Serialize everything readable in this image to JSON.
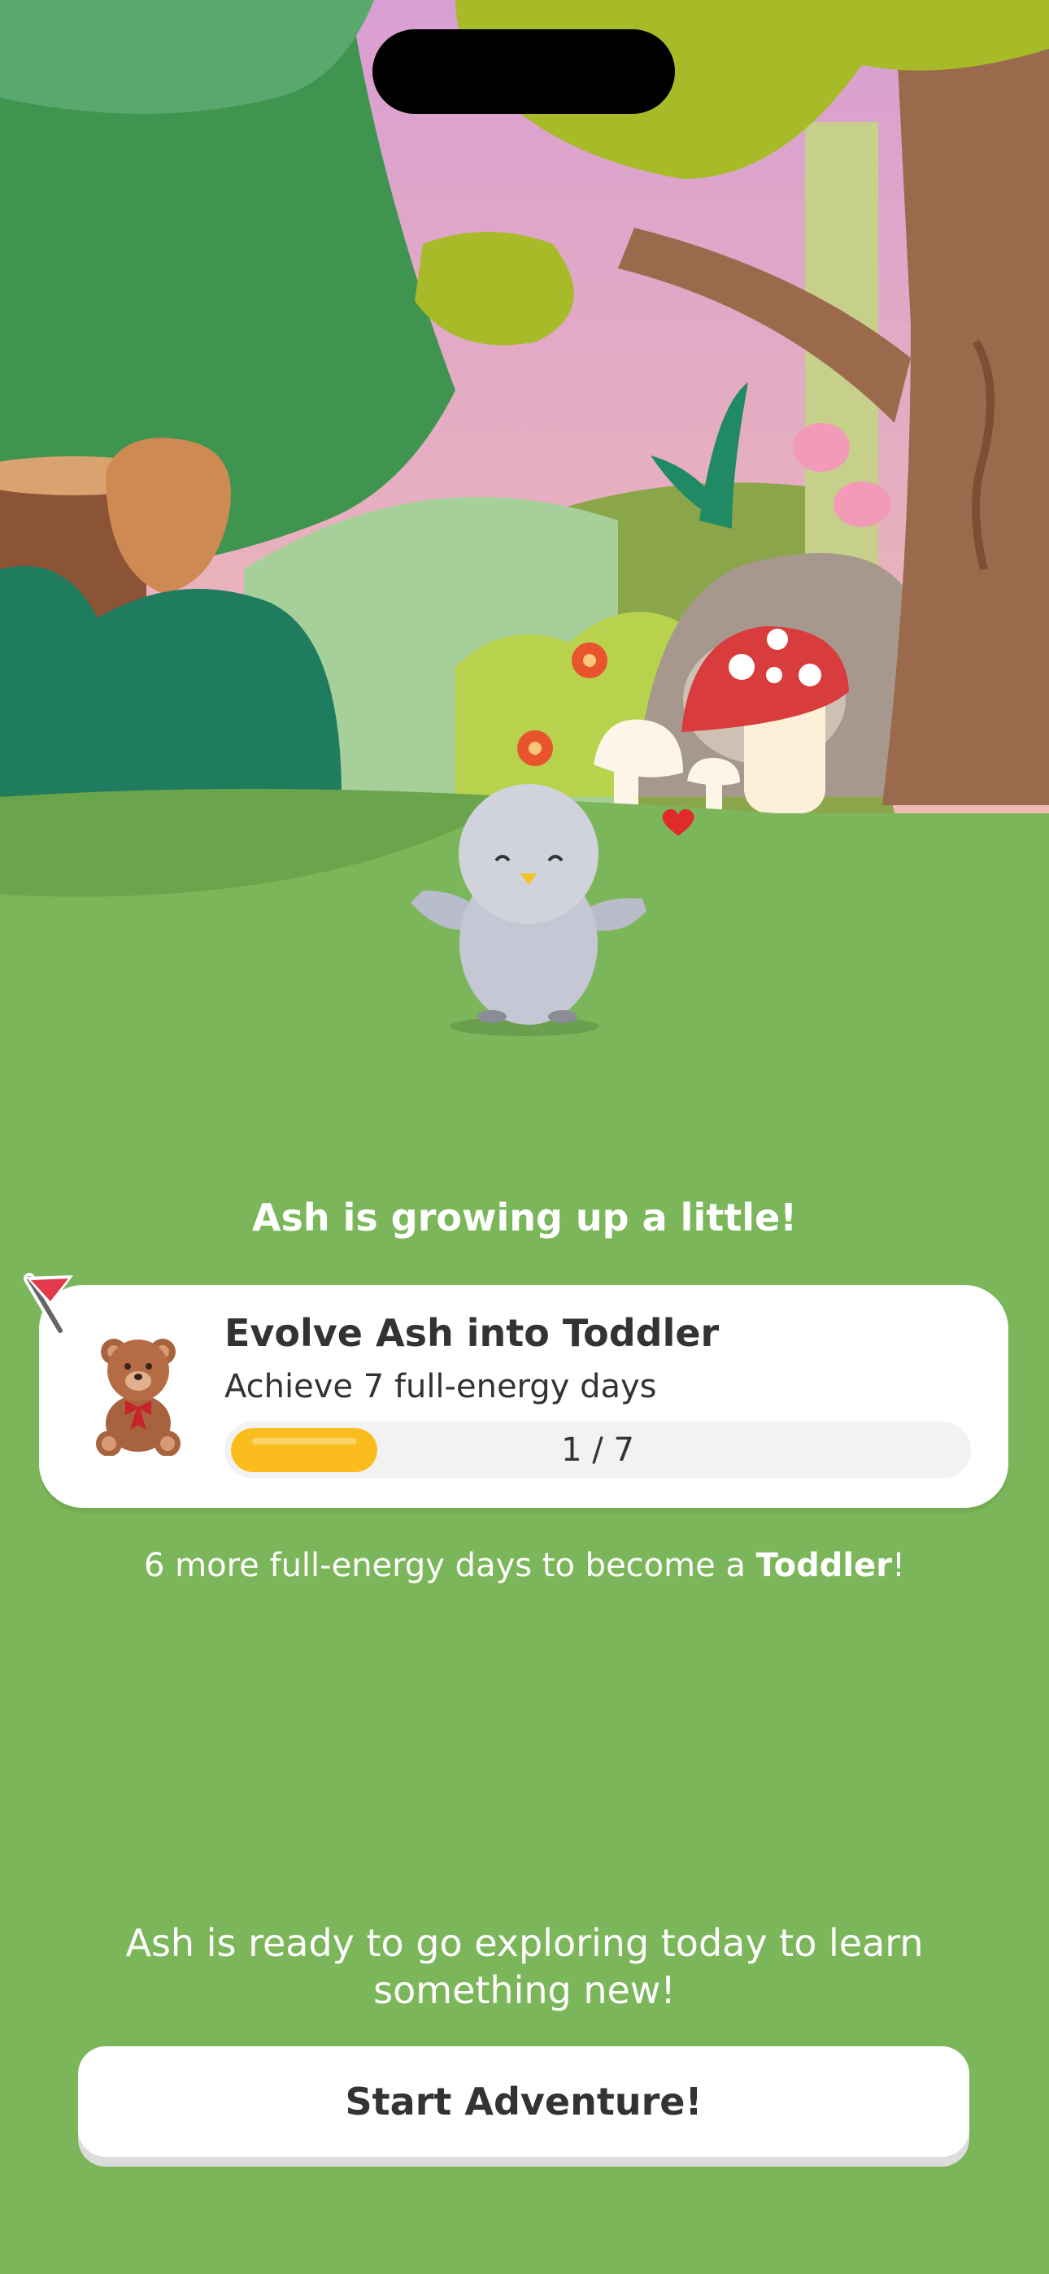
{
  "scene": {
    "pet_name": "Ash",
    "colors": {
      "sky_top": "#d89fd2",
      "sky_bottom": "#f0b9b3",
      "grass": "#7cb65a",
      "tree_dark": "#3f9450",
      "trunk": "#9b6a4c",
      "canopy": "#a6bb27"
    }
  },
  "headline": "Ash is growing up a little!",
  "goal_card": {
    "flag_icon": "red-flag-icon",
    "reward_icon": "teddy-bear-icon",
    "title": "Evolve Ash into Toddler",
    "subtitle": "Achieve 7 full-energy days",
    "progress_label": "1 / 7",
    "progress_current": 1,
    "progress_total": 7,
    "progress_color": "#fbbd1e"
  },
  "note": {
    "prefix": "6 more full-energy days to become a ",
    "stage": "Toddler",
    "suffix": "!"
  },
  "bottom_text": "Ash is ready to go exploring today to learn something new!",
  "start_button_label": "Start Adventure!"
}
